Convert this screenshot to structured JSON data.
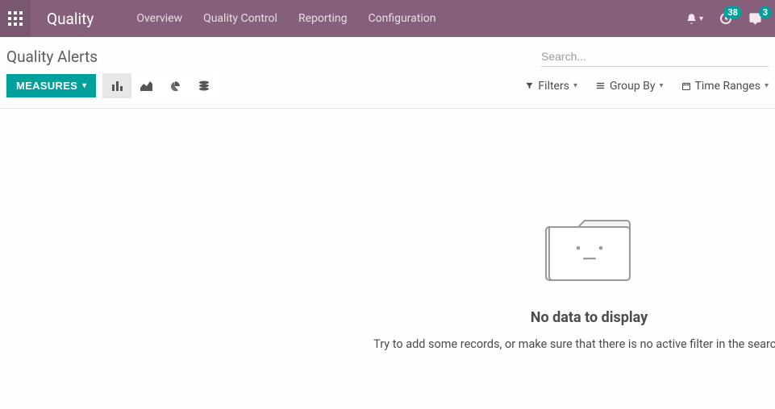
{
  "nav": {
    "app_title": "Quality",
    "links": [
      "Overview",
      "Quality Control",
      "Reporting",
      "Configuration"
    ],
    "badges": {
      "clock": "38",
      "chat": "3"
    }
  },
  "header": {
    "breadcrumb": "Quality Alerts",
    "search_placeholder": "Search..."
  },
  "toolbar": {
    "measures_label": "MEASURES",
    "filters_label": "Filters",
    "groupby_label": "Group By",
    "timeranges_label": "Time Ranges"
  },
  "empty": {
    "title": "No data to display",
    "subtitle": "Try to add some records, or make sure that there is no active filter in the search bar."
  }
}
